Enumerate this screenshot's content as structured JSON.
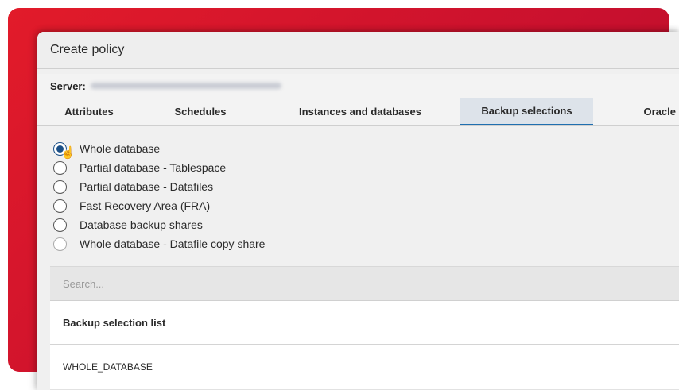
{
  "dialog": {
    "title": "Create policy",
    "server_label": "Server:"
  },
  "tabs": [
    {
      "label": "Attributes"
    },
    {
      "label": "Schedules"
    },
    {
      "label": "Instances and databases"
    },
    {
      "label": "Backup selections",
      "active": true
    },
    {
      "label": "Oracle"
    }
  ],
  "options": [
    {
      "label": "Whole database",
      "selected": true
    },
    {
      "label": "Partial database - Tablespace",
      "selected": false
    },
    {
      "label": "Partial database - Datafiles",
      "selected": false
    },
    {
      "label": "Fast Recovery Area (FRA)",
      "selected": false
    },
    {
      "label": "Database backup shares",
      "selected": false
    },
    {
      "label": "Whole database - Datafile copy share",
      "selected": false
    }
  ],
  "search": {
    "placeholder": "Search...",
    "value": ""
  },
  "backup_list": {
    "header": "Backup selection list",
    "items": [
      "WHOLE_DATABASE"
    ]
  },
  "colors": {
    "brand_red": "#e21b2a",
    "accent_blue": "#1f6fb0"
  },
  "icons": {
    "cursor": "hand-pointer-icon"
  }
}
